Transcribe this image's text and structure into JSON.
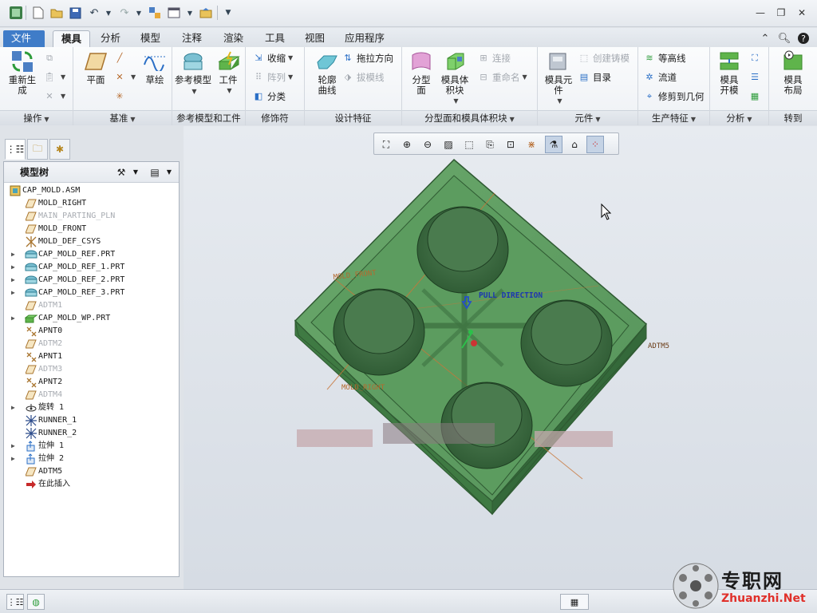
{
  "tabs": [
    {
      "label": "文件",
      "type": "file"
    },
    {
      "label": "模具",
      "type": "active"
    },
    {
      "label": "分析"
    },
    {
      "label": "模型"
    },
    {
      "label": "注释"
    },
    {
      "label": "渲染"
    },
    {
      "label": "工具"
    },
    {
      "label": "视图"
    },
    {
      "label": "应用程序"
    }
  ],
  "ribbon": {
    "groups": {
      "operation": "操作",
      "datum": "基准",
      "ref_model": "参考模型和工件",
      "decor": "修饰符",
      "design": "设计特征",
      "parting": "分型面和模具体积块",
      "component": "元件",
      "production": "生产特征",
      "analysis": "分析",
      "goto": "转到"
    },
    "regen": "重新生成",
    "plane": "平面",
    "sketch": "草绘",
    "ref_model_btn": "参考模型",
    "workpiece": "工件",
    "shrink": "收缩",
    "pattern": "阵列",
    "classify": "分类",
    "contour_curve": "轮廓曲线",
    "drag_dir": "拖拉方向",
    "draft_line": "拔模线",
    "parting_surface": "分型面",
    "mold_volume": "模具体积块",
    "connect": "连接",
    "rename": "重命名",
    "mold_component": "模具元件",
    "create_casting": "创建铸模",
    "catalog": "目录",
    "contour": "等高线",
    "runner": "流道",
    "trim_geom": "修剪到几何",
    "mold_open": "模具开模",
    "mold_layout": "模具布局"
  },
  "tree": {
    "title": "模型树",
    "items": [
      {
        "label": "CAP_MOLD.ASM",
        "icon": "assembly-icon",
        "root": true
      },
      {
        "label": "MOLD_RIGHT",
        "icon": "datum-plane-icon"
      },
      {
        "label": "MAIN_PARTING_PLN",
        "icon": "datum-plane-icon",
        "dim": true
      },
      {
        "label": "MOLD_FRONT",
        "icon": "datum-plane-icon"
      },
      {
        "label": "MOLD_DEF_CSYS",
        "icon": "csys-icon"
      },
      {
        "label": "CAP_MOLD_REF.PRT",
        "icon": "part-icon",
        "expand": true
      },
      {
        "label": "CAP_MOLD_REF_1.PRT",
        "icon": "part-icon",
        "expand": true
      },
      {
        "label": "CAP_MOLD_REF_2.PRT",
        "icon": "part-icon",
        "expand": true
      },
      {
        "label": "CAP_MOLD_REF_3.PRT",
        "icon": "part-icon",
        "expand": true
      },
      {
        "label": "ADTM1",
        "icon": "datum-plane-icon",
        "dim": true
      },
      {
        "label": "CAP_MOLD_WP.PRT",
        "icon": "workpiece-icon",
        "expand": true
      },
      {
        "label": "APNT0",
        "icon": "datum-point-icon"
      },
      {
        "label": "ADTM2",
        "icon": "datum-plane-icon",
        "dim": true
      },
      {
        "label": "APNT1",
        "icon": "datum-point-icon"
      },
      {
        "label": "ADTM3",
        "icon": "datum-plane-icon",
        "dim": true
      },
      {
        "label": "APNT2",
        "icon": "datum-point-icon"
      },
      {
        "label": "ADTM4",
        "icon": "datum-plane-icon",
        "dim": true
      },
      {
        "label": "旋转 1",
        "icon": "revolve-icon",
        "expand": true
      },
      {
        "label": "RUNNER_1",
        "icon": "runner-icon"
      },
      {
        "label": "RUNNER_2",
        "icon": "runner-icon"
      },
      {
        "label": "拉伸 1",
        "icon": "extrude-icon",
        "expand": true
      },
      {
        "label": "拉伸 2",
        "icon": "extrude-icon",
        "expand": true
      },
      {
        "label": "ADTM5",
        "icon": "datum-plane-icon"
      },
      {
        "label": "在此插入",
        "icon": "insert-here-icon"
      }
    ]
  },
  "scene": {
    "pull_direction": "PULL DIRECTION",
    "adtm5": "ADTM5"
  },
  "watermark": {
    "text": "专职网",
    "url": "Zhuanzhi.Net"
  },
  "colors": {
    "mold_green": "#5b9a5d",
    "datum_orange": "#c8763a",
    "accent_blue": "#3f7cc8"
  }
}
